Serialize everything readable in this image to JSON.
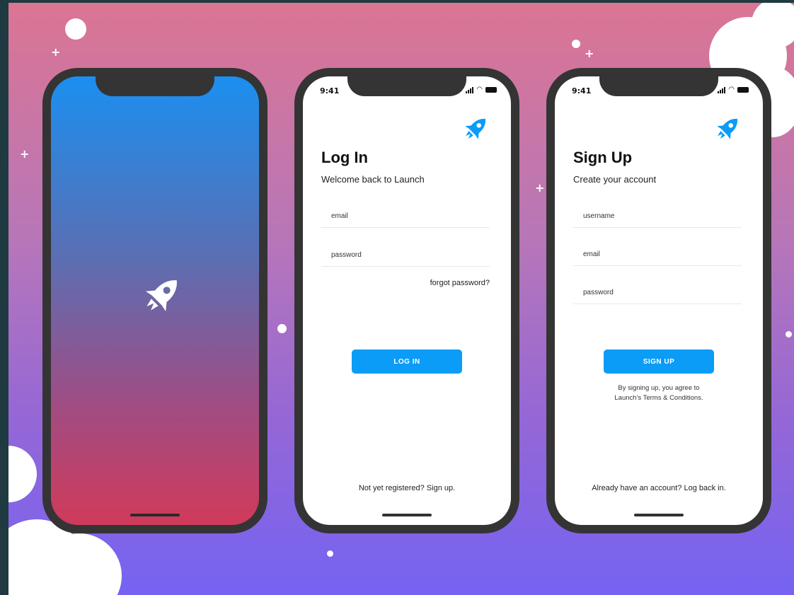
{
  "colors": {
    "accent": "#0a9cf6",
    "background_top": "#db7593",
    "background_bottom": "#7563f2",
    "phone_frame": "#343434"
  },
  "status_bar": {
    "time": "9:41"
  },
  "icons": {
    "rocket": "rocket-icon",
    "signal": "signal-icon",
    "wifi": "wifi-icon",
    "battery": "battery-icon"
  },
  "login": {
    "title": "Log In",
    "subtitle": "Welcome back to Launch",
    "email_placeholder": "email",
    "password_placeholder": "password",
    "forgot_label": "forgot password?",
    "button_label": "LOG IN",
    "bottom_link": "Not yet registered? Sign up."
  },
  "signup": {
    "title": "Sign Up",
    "subtitle": "Create your account",
    "username_placeholder": "username",
    "email_placeholder": "email",
    "password_placeholder": "password",
    "button_label": "SIGN UP",
    "terms_line1": "By signing up, you agree to",
    "terms_line2": "Launch's Terms & Conditions.",
    "bottom_link": "Already have an account? Log back in."
  }
}
